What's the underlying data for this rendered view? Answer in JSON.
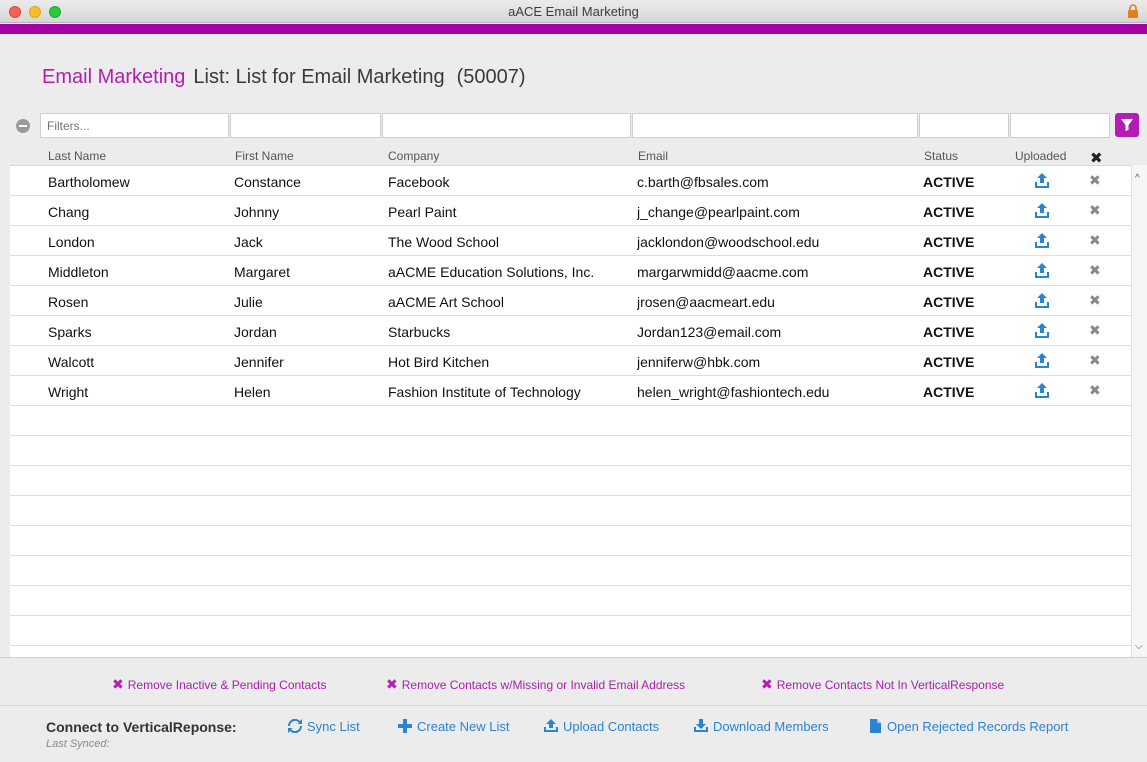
{
  "window": {
    "title": "aACE Email Marketing"
  },
  "colors": {
    "accent": "#b31db5",
    "link": "#2a84d2",
    "bar": "#a500a8"
  },
  "header": {
    "module": "Email Marketing",
    "title": "List: List for Email Marketing",
    "record_id": "(50007)"
  },
  "filters": {
    "placeholder": "Filters..."
  },
  "columns": [
    "Last Name",
    "First Name",
    "Company",
    "Email",
    "Status",
    "Uploaded"
  ],
  "rows": [
    {
      "last": "Bartholomew",
      "first": "Constance",
      "company": "Facebook",
      "email": "c.barth@fbsales.com",
      "status": "ACTIVE"
    },
    {
      "last": "Chang",
      "first": "Johnny",
      "company": "Pearl Paint",
      "email": "j_change@pearlpaint.com",
      "status": "ACTIVE"
    },
    {
      "last": "London",
      "first": "Jack",
      "company": "The Wood School",
      "email": "jacklondon@woodschool.edu",
      "status": "ACTIVE"
    },
    {
      "last": "Middleton",
      "first": "Margaret",
      "company": "aACME Education Solutions, Inc.",
      "email": "margarwmidd@aacme.com",
      "status": "ACTIVE"
    },
    {
      "last": "Rosen",
      "first": "Julie",
      "company": "aACME Art School",
      "email": "jrosen@aacmeart.edu",
      "status": "ACTIVE"
    },
    {
      "last": "Sparks",
      "first": "Jordan",
      "company": "Starbucks",
      "email": "Jordan123@email.com",
      "status": "ACTIVE"
    },
    {
      "last": "Walcott",
      "first": "Jennifer",
      "company": "Hot Bird Kitchen",
      "email": "jenniferw@hbk.com",
      "status": "ACTIVE"
    },
    {
      "last": "Wright",
      "first": "Helen",
      "company": "Fashion Institute of Technology",
      "email": "helen_wright@fashiontech.edu",
      "status": "ACTIVE"
    }
  ],
  "actions": {
    "remove_inactive": "Remove Inactive & Pending Contacts",
    "remove_invalid": "Remove Contacts w/Missing or Invalid Email Address",
    "remove_not_in_vr": "Remove Contacts Not In VerticalResponse"
  },
  "connect": {
    "label": "Connect to VerticalReponse:",
    "sync": "Sync List",
    "create": "Create New List",
    "upload": "Upload Contacts",
    "download": "Download Members",
    "rejected": "Open Rejected Records Report",
    "last_synced": "Last Synced:"
  }
}
